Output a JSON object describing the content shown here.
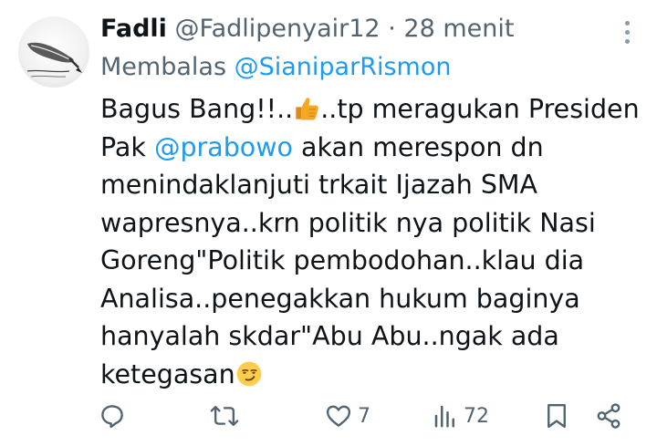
{
  "tweet": {
    "author_name": "Fadli",
    "handle": "@Fadlipenyair12",
    "separator": "·",
    "time": "28 menit",
    "replying_prefix": "Membalas",
    "replying_to": "@SianiparRismon",
    "lines": {
      "l1a": "Bagus Bang!!..",
      "l1b": "..tp meragukan Presiden",
      "l2a": "Pak ",
      "l2_mention": "@prabowo",
      "l2b": " akan merespon dn",
      "l3": "menindaklanjuti trkait Ijazah SMA",
      "l4": "wapresnya..krn politik nya politik Nasi",
      "l5": "Goreng\"Politik pembodohan..klau dia",
      "l6": "Analisa..penegakkan hukum baginya",
      "l7": "hanyalah skdar\"Abu Abu..ngak ada",
      "l8": "ketegasan"
    },
    "emojis": {
      "thumbs": "thumbs-up-emoji",
      "smirk": "smirking-face-emoji"
    }
  },
  "actions": {
    "reply": {
      "icon": "reply-icon",
      "count": ""
    },
    "retweet": {
      "icon": "retweet-icon",
      "count": ""
    },
    "like": {
      "icon": "heart-icon",
      "count": "7"
    },
    "views": {
      "icon": "views-icon",
      "count": "72"
    },
    "bookmark": {
      "icon": "bookmark-icon",
      "count": ""
    },
    "share": {
      "icon": "share-icon",
      "count": ""
    }
  },
  "colors": {
    "text": "#0f1419",
    "secondary": "#536471",
    "link": "#1d9bf0",
    "background": "#ffffff"
  }
}
